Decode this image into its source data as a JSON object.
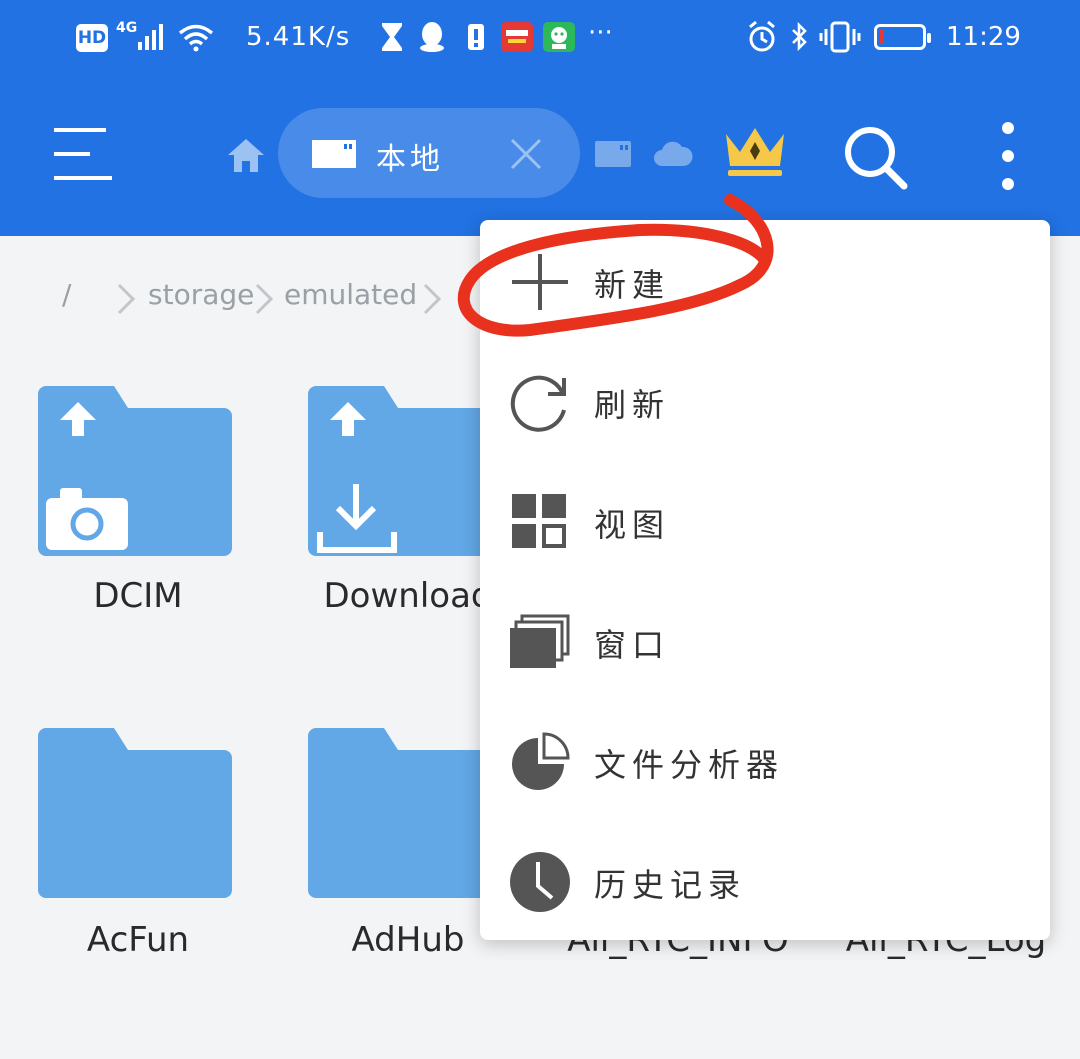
{
  "status_bar": {
    "hd": "HD",
    "network": "4G",
    "speed": "5.41K/s",
    "more": "···",
    "time": "11:29",
    "battery_level_pct": 10
  },
  "toolbar": {
    "location_label": "本地",
    "crown_color": "#f5c84a",
    "accent": "#2272e3"
  },
  "breadcrumb": [
    {
      "label": "/"
    },
    {
      "label": "storage"
    },
    {
      "label": "emulated"
    }
  ],
  "folders": [
    {
      "name": "DCIM",
      "overlay": "camera-icon"
    },
    {
      "name": "Download",
      "overlay": "download-icon"
    },
    {
      "name": "AcFun",
      "overlay": ""
    },
    {
      "name": "AdHub",
      "overlay": ""
    },
    {
      "name": "Ali_RTC_INFO",
      "overlay": ""
    },
    {
      "name": "Ali_RTC_Log",
      "overlay": ""
    }
  ],
  "menu": {
    "items": [
      {
        "label": "新建",
        "icon": "plus-icon"
      },
      {
        "label": "刷新",
        "icon": "refresh-icon"
      },
      {
        "label": "视图",
        "icon": "grid-view-icon"
      },
      {
        "label": "窗口",
        "icon": "windows-icon"
      },
      {
        "label": "文件分析器",
        "icon": "pie-chart-icon"
      },
      {
        "label": "历史记录",
        "icon": "clock-icon"
      }
    ]
  },
  "annotation_color": "#e8321e"
}
